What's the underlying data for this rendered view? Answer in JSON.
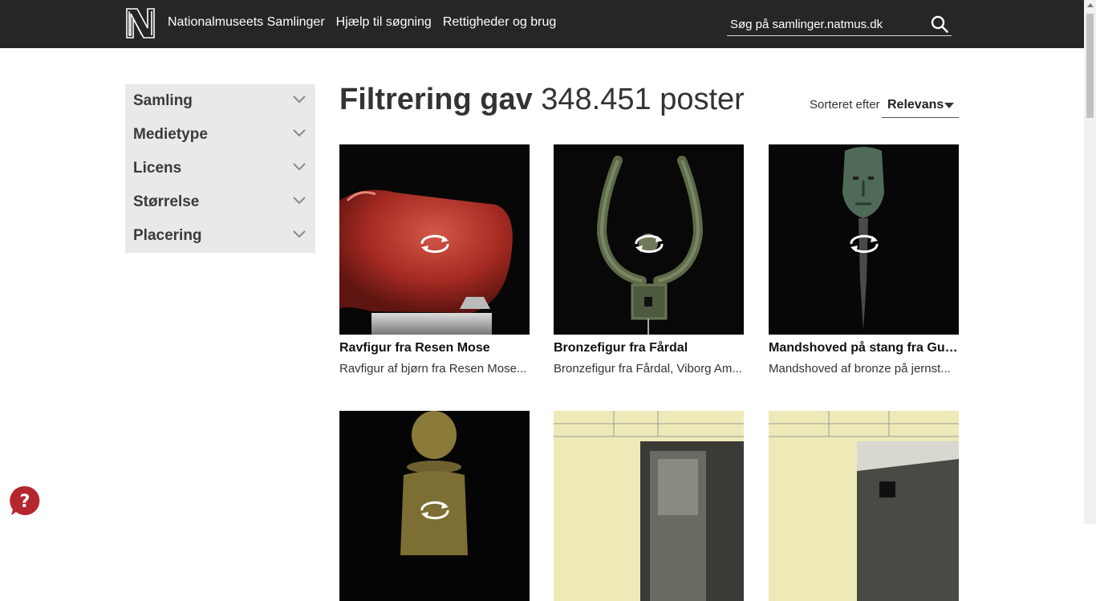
{
  "header": {
    "logo_letter": "N",
    "nav": [
      "Nationalmuseets Samlinger",
      "Hjælp til søgning",
      "Rettigheder og brug"
    ],
    "search_placeholder": "Søg på samlinger.natmus.dk"
  },
  "sidebar": {
    "facets": [
      "Samling",
      "Medietype",
      "Licens",
      "Størrelse",
      "Placering"
    ]
  },
  "results": {
    "heading_bold": "Filtrering gav",
    "heading_count": "348.451 poster",
    "sort_label": "Sorteret efter",
    "sort_value": "Relevans"
  },
  "cards": [
    {
      "title": "Ravfigur fra Resen Mose",
      "desc": "Ravfigur af bjørn fra Resen Mose..."
    },
    {
      "title": "Bronzefigur fra Fårdal",
      "desc": "Bronzefigur fra Fårdal, Viborg Am..."
    },
    {
      "title": "Mandshoved på stang fra Gudm...",
      "desc": "Mandshoved af bronze på jernst..."
    },
    {
      "title": "",
      "desc": ""
    },
    {
      "title": "",
      "desc": ""
    },
    {
      "title": "",
      "desc": ""
    }
  ],
  "colors": {
    "topbar": "#262626",
    "sidebar": "#e9e9e9",
    "help": "#b5262e"
  },
  "icons": [
    "nm-logo-icon",
    "search-icon",
    "chevron-down-icon",
    "caret-down-icon",
    "rotate-3d-icon",
    "help-question-icon"
  ]
}
